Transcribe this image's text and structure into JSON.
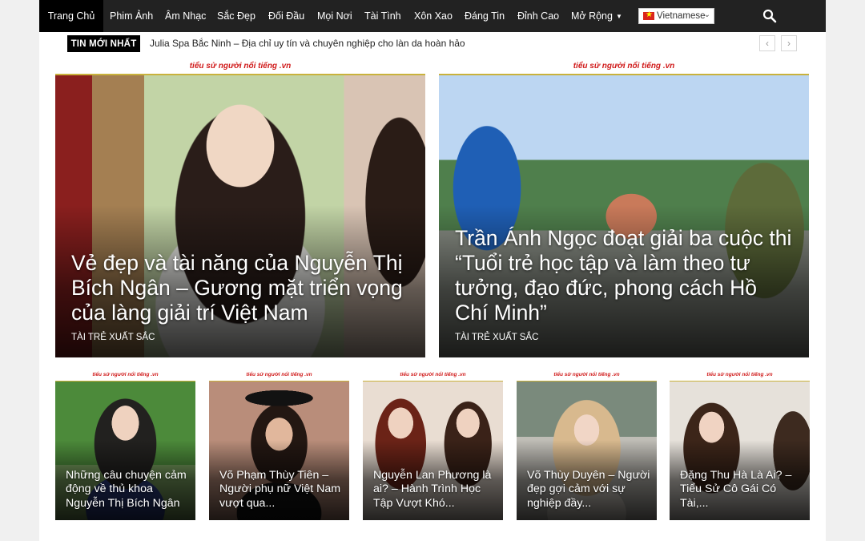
{
  "nav": {
    "items": [
      "Trang Chủ",
      "Phim Ảnh",
      "Âm Nhạc",
      "Sắc Đẹp",
      "Đối Đầu",
      "Mọi Nơi",
      "Tài Tình",
      "Xôn Xao",
      "Đáng Tin",
      "Đỉnh Cao"
    ],
    "more": "Mở Rộng",
    "language": "Vietnamese"
  },
  "ticker": {
    "badge": "TIN MỚI NHẤT",
    "headline": "Julia Spa Bắc Ninh – Địa chỉ uy tín và chuyên nghiệp cho làn da hoàn hảo"
  },
  "featured": [
    {
      "banner": "tiểu sử người nổi tiếng .vn",
      "title": "Vẻ đẹp và tài năng của Nguyễn Thị Bích Ngân – Gương mặt triển vọng của làng giải trí Việt Nam",
      "category": "TÀI TRẺ XUẤT SẮC"
    },
    {
      "banner": "tiểu sử người nổi tiếng .vn",
      "title": "Trần Ánh Ngọc đoạt giải ba cuộc thi “Tuổi trẻ học tập và làm theo tư tưởng, đạo đức, phong cách Hồ Chí Minh”",
      "category": "TÀI TRẺ XUẤT SẮC"
    }
  ],
  "cards": [
    {
      "banner": "tiểu sử người nổi tiếng .vn",
      "title": "Những câu chuyện cảm động về thủ khoa Nguyễn Thị Bích Ngân"
    },
    {
      "banner": "tiểu sử người nổi tiếng .vn",
      "title": "Võ Phạm Thùy Tiên – Người phụ nữ Việt Nam vượt qua..."
    },
    {
      "banner": "tiểu sử người nổi tiếng .vn",
      "title": "Nguyễn Lan Phương là ai? – Hành Trình Học Tập Vượt Khó..."
    },
    {
      "banner": "tiểu sử người nổi tiếng .vn",
      "title": "Võ Thùy Duyên – Người đẹp gợi cảm với sự nghiệp đầy..."
    },
    {
      "banner": "tiểu sử người nổi tiếng .vn",
      "title": "Đặng Thu Hà Là Ai? – Tiểu Sử Cô Gái Có Tài,..."
    }
  ]
}
